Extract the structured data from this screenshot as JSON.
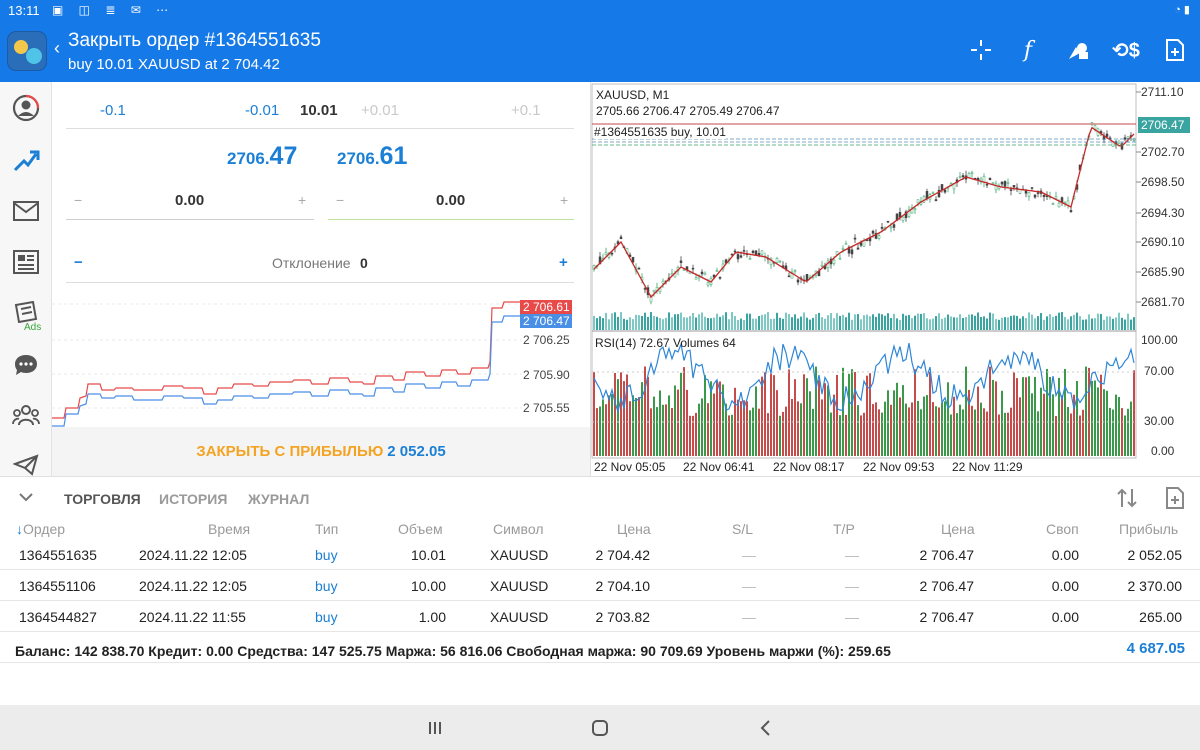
{
  "status_bar": {
    "time": "13:11"
  },
  "title_bar": {
    "title": "Закрыть ордер #1364551635",
    "subtitle": "buy 10.01 XAUUSD at 2 704.42",
    "icons": [
      "crosshair-icon",
      "function-icon",
      "objects-icon",
      "dollar-sync-icon",
      "new-order-icon"
    ]
  },
  "left_nav": {
    "icons": [
      "account-icon",
      "trade-icon",
      "mail-icon",
      "news-icon",
      "ads-icon",
      "chat-icon",
      "community-icon",
      "telegram-icon"
    ],
    "ads_label": "Ads"
  },
  "order_panel": {
    "volume": {
      "minus_big": "-0.1",
      "minus_small": "-0.01",
      "value": "10.01",
      "plus_small": "+0.01",
      "plus_big": "+0.1"
    },
    "bid": {
      "main": "2706.",
      "big": "47"
    },
    "ask": {
      "main": "2706.",
      "big": "61"
    },
    "sl": {
      "value": "0.00",
      "minus": "−",
      "plus": "+"
    },
    "tp": {
      "value": "0.00",
      "minus": "−",
      "plus": "+"
    },
    "deviation": {
      "label": "Отклонение",
      "value": "0",
      "minus": "−",
      "plus": "+"
    },
    "mini_chart": {
      "ask_tag": "2 706.61",
      "bid_tag": "2 706.47",
      "ticks": [
        "2 706.25",
        "2 705.90",
        "2 705.55"
      ]
    },
    "close_button": {
      "label": "ЗАКРЫТЬ С ПРИБЫЛЬЮ",
      "amount": "2 052.05"
    }
  },
  "chart": {
    "symbol_tf": "XAUUSD, M1",
    "ohlc": "2705.66 2706.47 2705.49 2706.47",
    "order_label": "#1364551635 buy, 10.01",
    "price_ticks": [
      "2711.10",
      "2702.70",
      "2698.50",
      "2694.30",
      "2690.10",
      "2685.90",
      "2681.70"
    ],
    "price_tag": "2706.47",
    "indicator_label": "RSI(14) 72.67 Volumes 64",
    "rsi_ticks": [
      "100.00",
      "70.00",
      "30.00",
      "0.00"
    ],
    "time_ticks": [
      "22 Nov 05:05",
      "22 Nov 06:41",
      "22 Nov 08:17",
      "22 Nov 09:53",
      "22 Nov 11:29"
    ]
  },
  "tabs": {
    "collapse_icon": "chevron-down-icon",
    "items": [
      "ТОРГОВЛЯ",
      "ИСТОРИЯ",
      "ЖУРНАЛ"
    ],
    "active": "ТОРГОВЛЯ",
    "right_icons": [
      "sort-icon",
      "add-document-icon"
    ]
  },
  "table": {
    "headers": [
      "Ордер",
      "Время",
      "Тип",
      "Объем",
      "Символ",
      "Цена",
      "S/L",
      "T/P",
      "Цена",
      "Своп",
      "Прибыль"
    ],
    "rows": [
      [
        "1364551635",
        "2024.11.22 12:05",
        "buy",
        "10.01",
        "XAUUSD",
        "2 704.42",
        "—",
        "—",
        "2 706.47",
        "0.00",
        "2 052.05"
      ],
      [
        "1364551106",
        "2024.11.22 12:05",
        "buy",
        "10.00",
        "XAUUSD",
        "2 704.10",
        "—",
        "—",
        "2 706.47",
        "0.00",
        "2 370.00"
      ],
      [
        "1364544827",
        "2024.11.22 11:55",
        "buy",
        "1.00",
        "XAUUSD",
        "2 703.82",
        "—",
        "—",
        "2 706.47",
        "0.00",
        "265.00"
      ]
    ]
  },
  "summary": {
    "text": "Баланс: 142 838.70  Кредит: 0.00  Средства: 147 525.75  Маржа: 56 816.06  Свободная маржа: 90 709.69  Уровень маржи (%): 259.65",
    "total": "4 687.05"
  },
  "colors": {
    "accent": "#1679e8",
    "blue_text": "#1b7fd6",
    "close_orange": "#f4a322",
    "ask_red": "#e84a4a",
    "bid_blue": "#4a8fe6",
    "price_tag_teal": "#3aa5a0"
  }
}
